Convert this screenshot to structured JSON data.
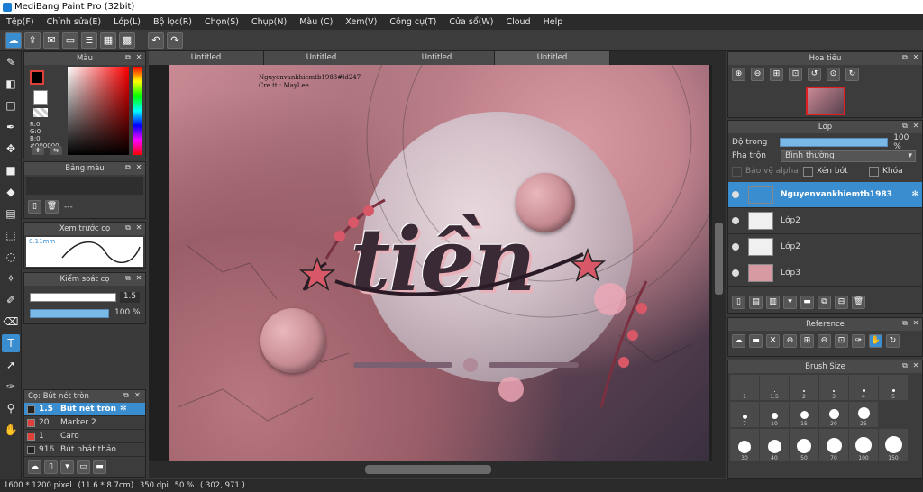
{
  "window": {
    "title": "MediBang Paint Pro (32bit)"
  },
  "menu": [
    "Tệp(F)",
    "Chỉnh sửa(E)",
    "Lớp(L)",
    "Bộ lọc(R)",
    "Chọn(S)",
    "Chụp(N)",
    "Màu (C)",
    "Xem(V)",
    "Công cụ(T)",
    "Cửa sổ(W)",
    "Cloud",
    "Help"
  ],
  "toolbar_icons": [
    "cloud-icon",
    "export-icon",
    "comment-icon",
    "page-icon",
    "page-list-icon",
    "grid-icon",
    "tiles-icon",
    "undo-icon",
    "redo-icon"
  ],
  "tools": [
    "brush-icon",
    "eraser-icon",
    "rectangle-icon",
    "pen-icon",
    "move-icon",
    "fill-icon",
    "bucket-icon",
    "gradient-icon",
    "select-rect-icon",
    "lasso-icon",
    "magic-wand-icon",
    "select-pen-icon",
    "select-eraser-icon",
    "text-icon",
    "operation-icon",
    "eyedropper-icon",
    "spoid-icon",
    "hand-icon"
  ],
  "color_panel": {
    "title": "Màu",
    "r": "R:0",
    "g": "G:0",
    "b": "B:0",
    "hex": "#000000"
  },
  "palette_panel": {
    "title": "Bảng màu",
    "dash": "---"
  },
  "preview_panel": {
    "title": "Xem trước cọ",
    "size": "0.11mm"
  },
  "control_panel": {
    "title": "Kiểm soát cọ",
    "size_value": "1.5",
    "opacity_value": "100 %"
  },
  "brush_panel": {
    "title": "Cọ: Bút nét tròn",
    "items": [
      {
        "size": "1.5",
        "name": "Bút nét tròn",
        "color": "#222222",
        "selected": true
      },
      {
        "size": "20",
        "name": "Marker 2",
        "color": "#e0403a",
        "selected": false
      },
      {
        "size": "1",
        "name": "Caro",
        "color": "#e0403a",
        "selected": false
      },
      {
        "size": "916",
        "name": "Bút phát thảo",
        "color": "#222222",
        "selected": false
      }
    ]
  },
  "tabs": [
    {
      "label": "Untitled"
    },
    {
      "label": "Untitled"
    },
    {
      "label": "Untitled"
    },
    {
      "label": "Untitled"
    }
  ],
  "canvas": {
    "watermark_line1": "Nguyenvankhiemtb1983#ld247",
    "watermark_line2": "Cre tt : MayLee",
    "art_text": "tiền"
  },
  "navigator": {
    "title": "Hoa tiêu"
  },
  "layer_panel": {
    "title": "Lớp",
    "opacity_label": "Độ trong",
    "opacity_value": "100 %",
    "opacity_pct": 100,
    "blend_label": "Pha trộn",
    "blend_value": "Bình thường",
    "protect_alpha": "Bảo vệ alpha",
    "clipping": "Xén bớt",
    "lock": "Khóa",
    "layers": [
      {
        "name": "Nguyenvankhiemtb1983",
        "selected": true
      },
      {
        "name": "Lớp2",
        "selected": false
      },
      {
        "name": "Lớp2",
        "selected": false
      },
      {
        "name": "Lớp3",
        "selected": false
      }
    ]
  },
  "reference_panel": {
    "title": "Reference"
  },
  "brushsize_panel": {
    "title": "Brush Size",
    "row1": [
      "1",
      "1.5",
      "2",
      "3",
      "4",
      "5"
    ],
    "row2": [
      "7",
      "10",
      "15",
      "20",
      "25"
    ],
    "row3": [
      "30",
      "40",
      "50",
      "70",
      "100",
      "150"
    ]
  },
  "status": {
    "dimensions": "1600 * 1200 pixel",
    "physical": "(11.6 * 8.7cm)",
    "dpi": "350 dpi",
    "zoom": "50 %",
    "coords": "( 302, 971 )"
  },
  "colors": {
    "accent": "#3a8ed0",
    "panel": "#3c3c3c",
    "brush_red": "#e0403a"
  }
}
